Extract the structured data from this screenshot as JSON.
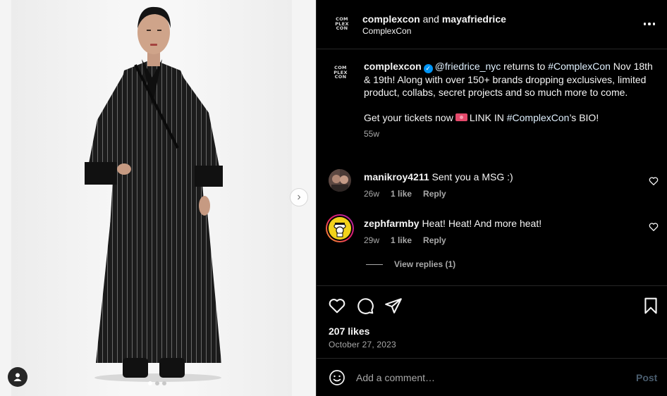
{
  "media": {
    "next_icon": "chevron-right-icon",
    "carousel": {
      "count": 3,
      "active_index": 0
    },
    "user_tag_icon": "person-icon"
  },
  "header": {
    "logo_lines": [
      "COM",
      "PLEX",
      "CON"
    ],
    "author": "complexcon",
    "and_text": "and",
    "collaborator": "mayafriedrice",
    "subtitle": "ComplexCon",
    "more_icon": "more-horizontal-icon"
  },
  "caption": {
    "username": "complexcon",
    "verified_icon": "verified-badge-icon",
    "mention": "@friedrice_nyc",
    "text_1": " returns to ",
    "hashtag_1": "#ComplexCon",
    "text_2": " Nov 18th & 19th! Along with over 150+ brands dropping exclusives, limited product, collabs, secret projects and so much more to come.",
    "text_3": "Get your tickets now",
    "ticket_icon": "ticket-emoji-icon",
    "text_4": "LINK IN ",
    "hashtag_2": "#ComplexCon",
    "text_5": "’s BIO!",
    "time": "55w"
  },
  "comments": [
    {
      "username": "manikroy4211",
      "text": "Sent you a MSG :)",
      "time": "26w",
      "likes": "1 like",
      "reply": "Reply"
    },
    {
      "username": "zephfarmby",
      "text": "Heat! Heat! And more heat!",
      "time": "29w",
      "likes": "1 like",
      "reply": "Reply"
    }
  ],
  "view_replies": "View replies (1)",
  "actions": {
    "like_icon": "heart-icon",
    "comment_icon": "comment-icon",
    "share_icon": "send-icon",
    "save_icon": "bookmark-icon",
    "likes": "207 likes",
    "date": "October 27, 2023"
  },
  "add_comment": {
    "emoji_icon": "smiley-icon",
    "placeholder": "Add a comment…",
    "post_label": "Post"
  },
  "colors": {
    "background": "#000000",
    "text": "#f5f5f5",
    "muted": "#a8a8a8",
    "link": "#e0f1ff",
    "verified": "#0095f6",
    "divider": "#262626"
  }
}
